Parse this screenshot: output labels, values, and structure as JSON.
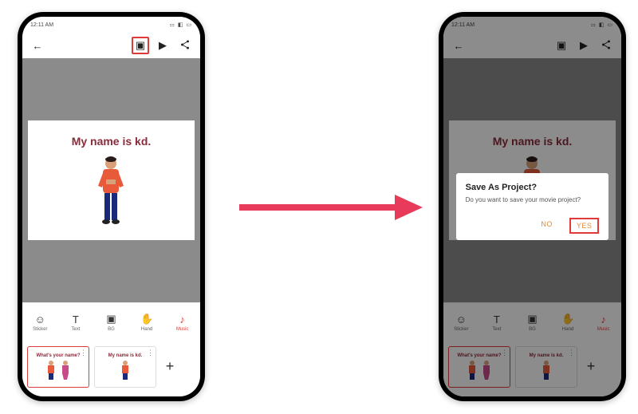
{
  "statusbar": {
    "time": "12:11 AM",
    "carrier": "• ▪ ▪",
    "right": "⚏ ◧ ▭"
  },
  "appbar": {
    "back": "←",
    "save": "▣",
    "play": "▶",
    "share": "⫘"
  },
  "canvas": {
    "title": "My name is kd."
  },
  "tools": [
    {
      "icon": "☺",
      "label": "Sticker"
    },
    {
      "icon": "T",
      "label": "Text"
    },
    {
      "icon": "▣",
      "label": "BG"
    },
    {
      "icon": "✋",
      "label": "Hand"
    },
    {
      "icon": "♪",
      "label": "Music"
    }
  ],
  "clips": [
    {
      "title": "What's your name?",
      "selected": true
    },
    {
      "title": "My name is kd.",
      "selected": false
    }
  ],
  "add_clip": "+",
  "dialog": {
    "title": "Save As Project?",
    "message": "Do you want to save your movie project?",
    "no": "NO",
    "yes": "YES"
  }
}
